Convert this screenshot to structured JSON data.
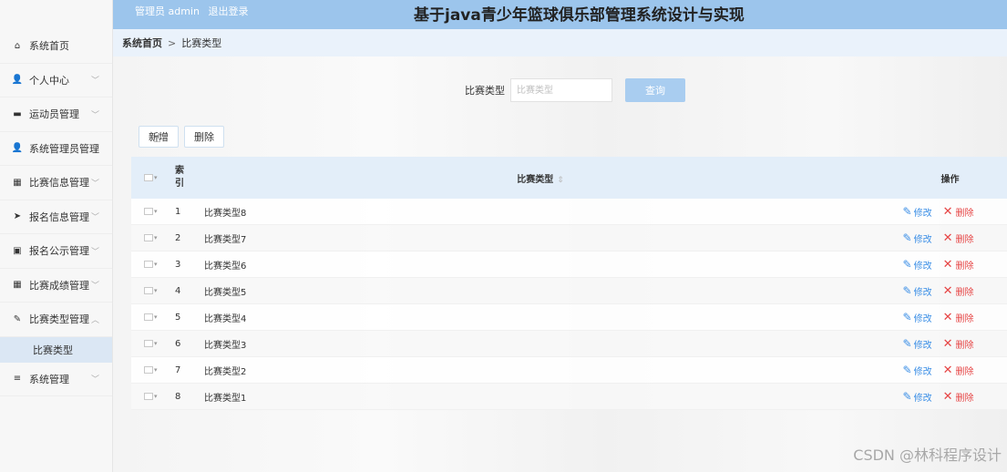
{
  "header": {
    "admin_role": "管理员 admin",
    "logout": "退出登录",
    "title": "基于java青少年篮球俱乐部管理系统设计与实现",
    "bg_color": "#9cc5ec"
  },
  "sidebar": {
    "items": [
      {
        "label": "系统首页",
        "icon": "home-icon",
        "glyph": "⌂",
        "chevron": ""
      },
      {
        "label": "个人中心",
        "icon": "user-icon",
        "glyph": "👤",
        "chevron": "﹀"
      },
      {
        "label": "运动员管理",
        "icon": "briefcase-icon",
        "glyph": "▬",
        "chevron": "﹀"
      },
      {
        "label": "系统管理员管理",
        "icon": "user-icon",
        "glyph": "👤",
        "chevron": "﹀"
      },
      {
        "label": "比赛信息管理",
        "icon": "grid-icon",
        "glyph": "▦",
        "chevron": "﹀"
      },
      {
        "label": "报名信息管理",
        "icon": "send-icon",
        "glyph": "➤",
        "chevron": "﹀"
      },
      {
        "label": "报名公示管理",
        "icon": "clipboard-icon",
        "glyph": "▣",
        "chevron": "﹀"
      },
      {
        "label": "比赛成绩管理",
        "icon": "grid-icon",
        "glyph": "▦",
        "chevron": "﹀"
      },
      {
        "label": "比赛类型管理",
        "icon": "thumbs-up-icon",
        "glyph": "✎",
        "chevron": "︿"
      }
    ],
    "submenu_item": "比赛类型",
    "last_item": {
      "label": "系统管理",
      "icon": "list-icon",
      "glyph": "≡",
      "chevron": "﹀"
    }
  },
  "breadcrumb": {
    "home": "系统首页",
    "separator": ">",
    "current": "比赛类型"
  },
  "search": {
    "label": "比赛类型",
    "placeholder": "比赛类型",
    "button": "查询"
  },
  "actions": {
    "add": "新增",
    "delete": "删除"
  },
  "table": {
    "headers": {
      "index": "索引",
      "type": "比赛类型",
      "sort": "⇕",
      "ops": "操作"
    },
    "rows": [
      {
        "index": "1",
        "type": "比赛类型8"
      },
      {
        "index": "2",
        "type": "比赛类型7"
      },
      {
        "index": "3",
        "type": "比赛类型6"
      },
      {
        "index": "4",
        "type": "比赛类型5"
      },
      {
        "index": "5",
        "type": "比赛类型4"
      },
      {
        "index": "6",
        "type": "比赛类型3"
      },
      {
        "index": "7",
        "type": "比赛类型2"
      },
      {
        "index": "8",
        "type": "比赛类型1"
      }
    ],
    "edit_label": "修改",
    "delete_label": "删除"
  },
  "watermark": "CSDN @林科程序设计"
}
